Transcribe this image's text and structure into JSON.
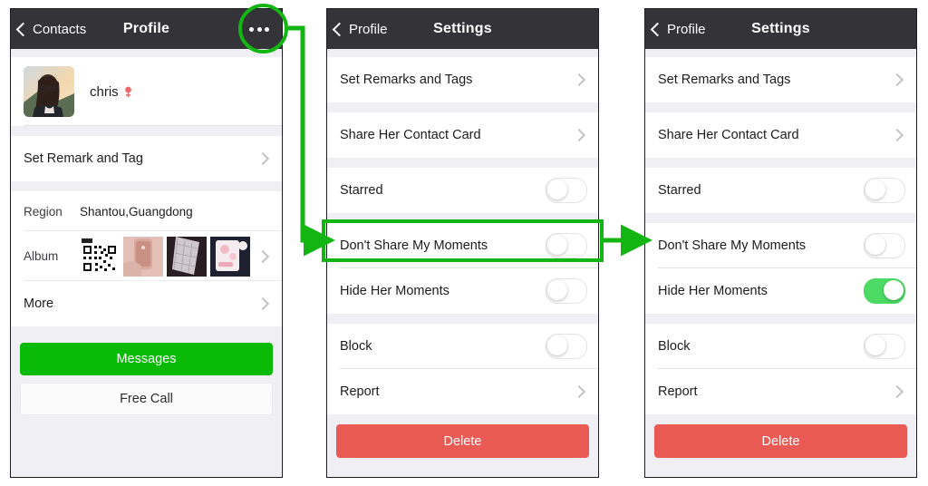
{
  "panels": [
    {
      "id": "profile",
      "nav": {
        "back_label": "Contacts",
        "title": "Profile",
        "more_icon": "ellipsis-icon"
      },
      "contact": {
        "name": "chris",
        "gender_icon": "female-icon",
        "avatar_icon": "user-photo"
      },
      "rows": [
        {
          "label": "Set Remark and Tag",
          "accessory": "chevron"
        }
      ],
      "region": {
        "key": "Region",
        "value": "Shantou,Guangdong"
      },
      "album": {
        "key": "Album",
        "accessory": "chevron",
        "thumbs": [
          "qr-code-thumb",
          "rose-gold-phone-thumb",
          "quilted-case-thumb",
          "pink-case-thumb"
        ]
      },
      "more": {
        "label": "More",
        "accessory": "chevron"
      },
      "buttons": {
        "messages": "Messages",
        "free_call": "Free Call"
      }
    },
    {
      "id": "settings-before",
      "nav": {
        "back_label": "Profile",
        "title": "Settings"
      },
      "rows": [
        {
          "label": "Set Remarks and Tags",
          "accessory": "chevron"
        },
        {
          "label": "Share Her Contact Card",
          "accessory": "chevron"
        },
        {
          "label": "Starred",
          "accessory": "toggle",
          "on": false
        },
        {
          "label": "Don't Share My Moments",
          "accessory": "toggle",
          "on": false
        },
        {
          "label": "Hide Her Moments",
          "accessory": "toggle",
          "on": false
        },
        {
          "label": "Block",
          "accessory": "toggle",
          "on": false
        },
        {
          "label": "Report",
          "accessory": "chevron"
        }
      ],
      "delete_label": "Delete"
    },
    {
      "id": "settings-after",
      "nav": {
        "back_label": "Profile",
        "title": "Settings"
      },
      "rows": [
        {
          "label": "Set Remarks and Tags",
          "accessory": "chevron"
        },
        {
          "label": "Share Her Contact Card",
          "accessory": "chevron"
        },
        {
          "label": "Starred",
          "accessory": "toggle",
          "on": false
        },
        {
          "label": "Don't Share My Moments",
          "accessory": "toggle",
          "on": false
        },
        {
          "label": "Hide Her Moments",
          "accessory": "toggle",
          "on": true
        },
        {
          "label": "Block",
          "accessory": "toggle",
          "on": false
        },
        {
          "label": "Report",
          "accessory": "chevron"
        }
      ],
      "delete_label": "Delete"
    }
  ],
  "annotations": {
    "highlight_color": "#12B512",
    "circle_target": "ellipsis-icon",
    "box_target": "hide-her-moments-row"
  },
  "colors": {
    "navbar": "#343438",
    "accent_green": "#09BB07",
    "toggle_on": "#4CD964",
    "delete_red": "#E95A55",
    "page_bg": "#efeff4"
  }
}
